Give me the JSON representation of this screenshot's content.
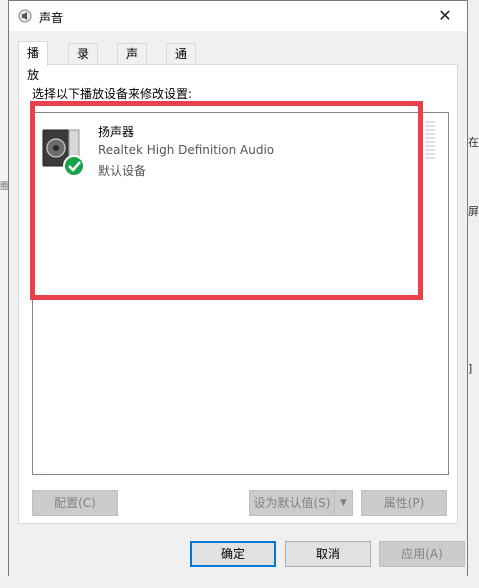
{
  "window": {
    "title": "声音",
    "close_glyph": "✕"
  },
  "tabs": [
    {
      "label": "播放"
    },
    {
      "label": "录制"
    },
    {
      "label": "声音"
    },
    {
      "label": "通信"
    }
  ],
  "playback": {
    "instruction": "选择以下播放设备来修改设置:",
    "device": {
      "name": "扬声器",
      "driver": "Realtek High Definition Audio",
      "status": "默认设备"
    },
    "buttons": {
      "configure": "配置(C)",
      "set_default": "设为默认值(S)",
      "set_default_arrow": "▼",
      "properties": "属性(P)"
    }
  },
  "dialog_buttons": {
    "ok": "确定",
    "cancel": "取消",
    "apply": "应用(A)"
  },
  "background": {
    "right_chip_1": "在",
    "right_chip_2": "屏",
    "right_chip_3": "]",
    "left_text": "圈"
  },
  "colors": {
    "highlight": "#e8414b",
    "accent": "#0078d7",
    "check": "#16a34a"
  }
}
